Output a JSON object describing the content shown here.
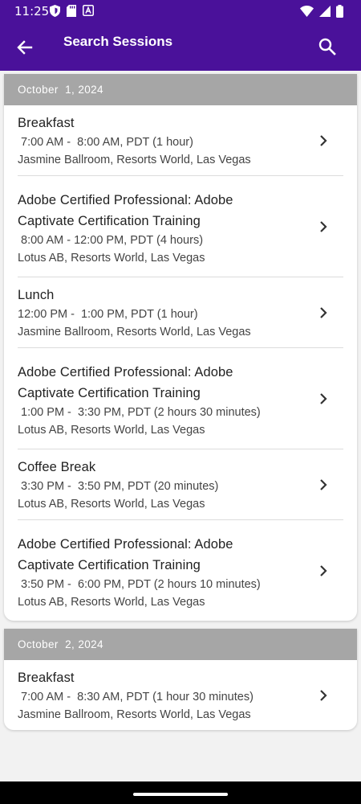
{
  "status_bar": {
    "time": "11:25",
    "left_icons": [
      "shield-icon",
      "sd-card-icon",
      "app-a-icon"
    ],
    "right_icons": [
      "wifi-icon",
      "signal-icon",
      "battery-icon"
    ]
  },
  "app_bar": {
    "title": "Search Sessions",
    "back_icon": "arrow-left-icon",
    "search_icon": "search-icon",
    "color": "#4a119a"
  },
  "days": [
    {
      "date": "October  1, 2024",
      "sessions": [
        {
          "title_lines": [
            "Breakfast"
          ],
          "time": " 7:00 AM -  8:00 AM, PDT (1 hour)",
          "location": "Jasmine Ballroom, Resorts World, Las Vegas"
        },
        {
          "title_lines": [
            "Adobe Certified Professional: Adobe",
            "Captivate Certification Training"
          ],
          "time": " 8:00 AM - 12:00 PM, PDT (4 hours)",
          "location": "Lotus AB, Resorts World, Las Vegas"
        },
        {
          "title_lines": [
            "Lunch"
          ],
          "time": "12:00 PM -  1:00 PM, PDT (1 hour)",
          "location": "Jasmine Ballroom, Resorts World, Las Vegas"
        },
        {
          "title_lines": [
            "Adobe Certified Professional: Adobe",
            "Captivate Certification Training"
          ],
          "time": " 1:00 PM -  3:30 PM, PDT (2 hours 30 minutes)",
          "location": "Lotus AB, Resorts World, Las Vegas"
        },
        {
          "title_lines": [
            "Coffee Break"
          ],
          "time": " 3:30 PM -  3:50 PM, PDT (20 minutes)",
          "location": "Lotus AB, Resorts World, Las Vegas"
        },
        {
          "title_lines": [
            "Adobe Certified Professional: Adobe",
            "Captivate Certification Training"
          ],
          "time": " 3:50 PM -  6:00 PM, PDT (2 hours 10 minutes)",
          "location": "Lotus AB, Resorts World, Las Vegas"
        }
      ]
    },
    {
      "date": "October  2, 2024",
      "sessions": [
        {
          "title_lines": [
            "Breakfast"
          ],
          "time": " 7:00 AM -  8:30 AM, PDT (1 hour 30 minutes)",
          "location": "Jasmine Ballroom, Resorts World, Las Vegas"
        }
      ]
    }
  ],
  "colors": {
    "day_header_bg": "#a6a6a6",
    "divider": "#dcdcdc"
  }
}
